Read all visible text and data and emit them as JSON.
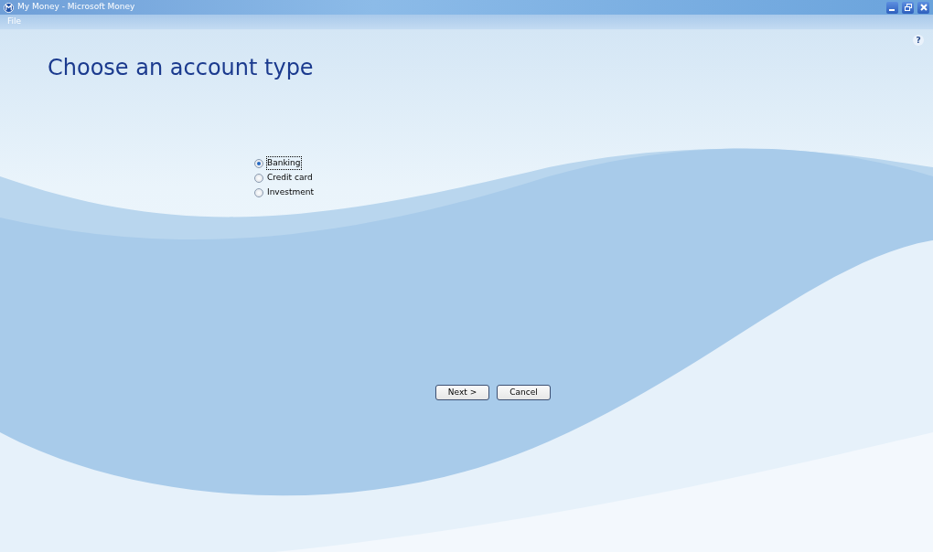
{
  "window": {
    "title": "My Money - Microsoft Money"
  },
  "menu": [
    {
      "label": "File"
    }
  ],
  "help": {
    "label": "?"
  },
  "heading": "Choose an account type",
  "options": [
    {
      "label": "Banking",
      "selected": true
    },
    {
      "label": "Credit card",
      "selected": false
    },
    {
      "label": "Investment",
      "selected": false
    }
  ],
  "buttons": [
    {
      "label": "Next >"
    },
    {
      "label": "Cancel"
    }
  ]
}
